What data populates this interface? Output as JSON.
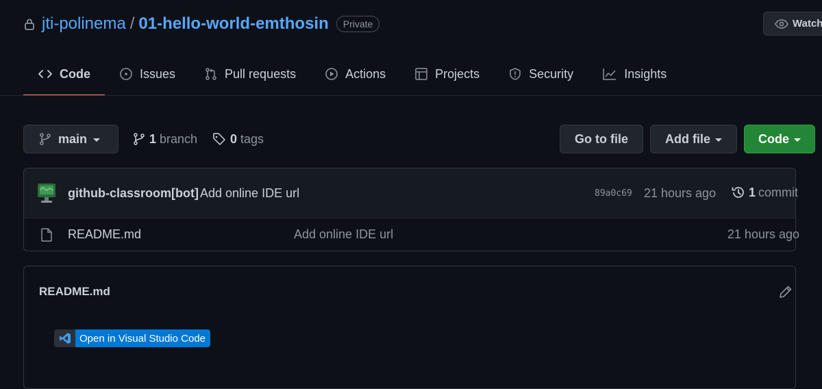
{
  "repo": {
    "owner": "jti-polinema",
    "separator": "/",
    "name": "01-hello-world-emthosin",
    "visibility": "Private"
  },
  "actions": {
    "watch_label": "Watch"
  },
  "tabs": [
    {
      "label": "Code",
      "icon": "code-icon",
      "active": true
    },
    {
      "label": "Issues",
      "icon": "issue-opened-icon"
    },
    {
      "label": "Pull requests",
      "icon": "git-pull-request-icon"
    },
    {
      "label": "Actions",
      "icon": "play-icon"
    },
    {
      "label": "Projects",
      "icon": "table-icon"
    },
    {
      "label": "Security",
      "icon": "shield-icon"
    },
    {
      "label": "Insights",
      "icon": "graph-icon"
    }
  ],
  "toolbar": {
    "branch": "main",
    "branch_count": "1",
    "branch_word": "branch",
    "tag_count": "0",
    "tag_word": "tags",
    "go_to_file": "Go to file",
    "add_file": "Add file",
    "code": "Code"
  },
  "latest_commit": {
    "author": "github-classroom[bot]",
    "message": "Add online IDE url",
    "sha": "89a0c69",
    "time": "21 hours ago",
    "commit_count": "1",
    "commit_word": "commit"
  },
  "files": [
    {
      "name": "README.md",
      "message": "Add online IDE url",
      "time": "21 hours ago",
      "icon": "file-icon"
    }
  ],
  "readme": {
    "title": "README.md",
    "badge_label": "Open in Visual Studio Code"
  },
  "colors": {
    "background": "#0d1117",
    "link": "#58a6ff",
    "active_tab_underline": "#f78166",
    "code_button": "#238636",
    "vscode_badge": "#0078d4"
  }
}
